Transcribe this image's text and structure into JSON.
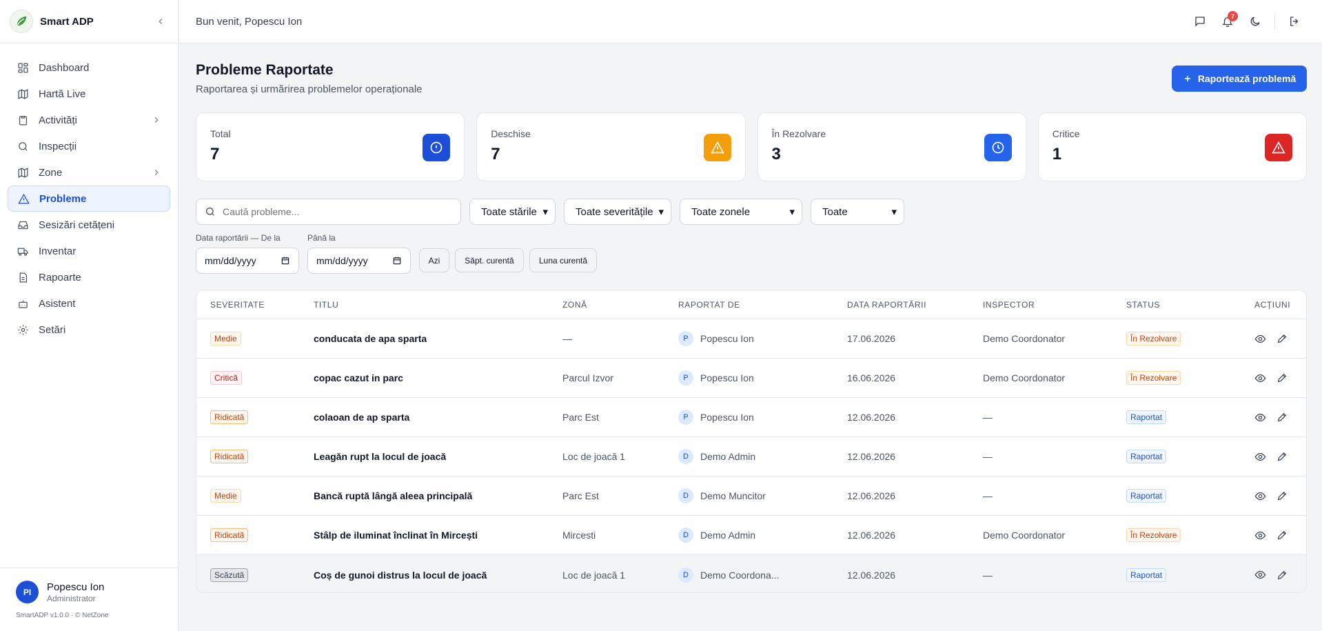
{
  "app": {
    "name": "Smart ADP",
    "version": "SmartADP v1.0.0 · © NetZone"
  },
  "sidebar": {
    "items": [
      {
        "label": "Dashboard",
        "icon": "dashboard-icon"
      },
      {
        "label": "Hartă Live",
        "icon": "map-icon"
      },
      {
        "label": "Activități",
        "icon": "clipboard-icon",
        "has_children": true
      },
      {
        "label": "Inspecții",
        "icon": "search-icon"
      },
      {
        "label": "Zone",
        "icon": "map-icon",
        "has_children": true
      },
      {
        "label": "Probleme",
        "icon": "warning-icon",
        "active": true
      },
      {
        "label": "Sesizări cetățeni",
        "icon": "inbox-icon"
      },
      {
        "label": "Inventar",
        "icon": "truck-icon"
      },
      {
        "label": "Rapoarte",
        "icon": "file-icon"
      },
      {
        "label": "Asistent",
        "icon": "bot-icon"
      },
      {
        "label": "Setări",
        "icon": "gear-icon"
      }
    ],
    "user": {
      "initials": "PI",
      "name": "Popescu Ion",
      "role": "Administrator"
    }
  },
  "topbar": {
    "welcome": "Bun venit, Popescu Ion",
    "notifications": "7"
  },
  "page": {
    "title": "Probleme Raportate",
    "subtitle": "Raportarea și urmărirea problemelor operaționale",
    "report_button": "Raportează problemă"
  },
  "stats": [
    {
      "label": "Total",
      "value": "7",
      "color": "#1d4ed8",
      "icon": "info-icon"
    },
    {
      "label": "Deschise",
      "value": "7",
      "color": "#f59e0b",
      "icon": "warning-icon"
    },
    {
      "label": "În Rezolvare",
      "value": "3",
      "color": "#2563eb",
      "icon": "clock-icon"
    },
    {
      "label": "Critice",
      "value": "1",
      "color": "#dc2626",
      "icon": "warning-icon"
    }
  ],
  "filters": {
    "search_placeholder": "Caută probleme...",
    "status": "Toate stările",
    "severity": "Toate severitățile",
    "zone": "Toate zonele",
    "other": "Toate",
    "date_from_label": "Data raportării — De la",
    "date_to_label": "Până la",
    "date_placeholder": "mm/dd/yyyy",
    "quick": [
      "Azi",
      "Săpt. curentă",
      "Luna curentă"
    ]
  },
  "table": {
    "headers": [
      "SEVERITATE",
      "TITLU",
      "ZONĂ",
      "RAPORTAT DE",
      "DATA RAPORTĂRII",
      "INSPECTOR",
      "STATUS",
      "ACȚIUNI"
    ],
    "rows": [
      {
        "severity": "Medie",
        "sev_class": "b-medie",
        "title": "conducata de apa sparta",
        "zone": "—",
        "initial": "P",
        "reporter": "Popescu Ion",
        "date": "17.06.2026",
        "inspector": "Demo Coordonator",
        "status": "În Rezolvare",
        "status_class": "s-rez"
      },
      {
        "severity": "Critică",
        "sev_class": "b-critica",
        "title": "copac cazut in parc",
        "zone": "Parcul Izvor",
        "initial": "P",
        "reporter": "Popescu Ion",
        "date": "16.06.2026",
        "inspector": "Demo Coordonator",
        "status": "În Rezolvare",
        "status_class": "s-rez"
      },
      {
        "severity": "Ridicată",
        "sev_class": "b-ridicata",
        "title": "colaoan de ap sparta",
        "zone": "Parc Est",
        "initial": "P",
        "reporter": "Popescu Ion",
        "date": "12.06.2026",
        "inspector": "—",
        "status": "Raportat",
        "status_class": "s-rap"
      },
      {
        "severity": "Ridicată",
        "sev_class": "b-ridicata",
        "title": "Leagăn rupt la locul de joacă",
        "zone": "Loc de joacă 1",
        "initial": "D",
        "reporter": "Demo Admin",
        "date": "12.06.2026",
        "inspector": "—",
        "status": "Raportat",
        "status_class": "s-rap"
      },
      {
        "severity": "Medie",
        "sev_class": "b-medie",
        "title": "Bancă ruptă lângă aleea principală",
        "zone": "Parc Est",
        "initial": "D",
        "reporter": "Demo Muncitor",
        "date": "12.06.2026",
        "inspector": "—",
        "status": "Raportat",
        "status_class": "s-rap"
      },
      {
        "severity": "Ridicată",
        "sev_class": "b-ridicata",
        "title": "Stâlp de iluminat înclinat în Mircești",
        "zone": "Mircesti",
        "initial": "D",
        "reporter": "Demo Admin",
        "date": "12.06.2026",
        "inspector": "Demo Coordonator",
        "status": "În Rezolvare",
        "status_class": "s-rez"
      },
      {
        "severity": "Scăzută",
        "sev_class": "b-scazuta",
        "title": "Coș de gunoi distrus la locul de joacă",
        "zone": "Loc de joacă 1",
        "initial": "D",
        "reporter": "Demo Coordona...",
        "date": "12.06.2026",
        "inspector": "—",
        "status": "Raportat",
        "status_class": "s-rap"
      }
    ]
  }
}
